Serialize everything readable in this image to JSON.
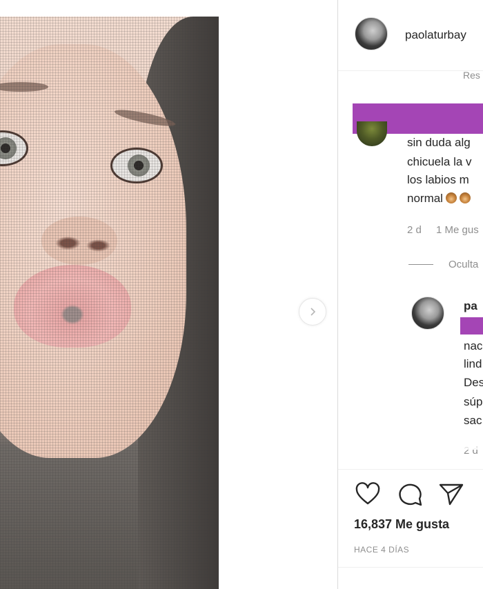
{
  "post": {
    "username": "paolaturbay",
    "reply_link": "Res"
  },
  "comments": [
    {
      "lines": [
        "sin duda alg",
        "chicuela la v",
        "los labios m",
        "normal"
      ],
      "time": "2 d",
      "likes": "1 Me gus",
      "hide_replies": "Oculta"
    }
  ],
  "reply": {
    "username": "pa",
    "lines": [
      "nac",
      "lind",
      "Des",
      "súp",
      "sac"
    ],
    "time": "2 d"
  },
  "actions": {
    "like_count": "16,837 Me gusta",
    "posted": "HACE 4 DÍAS"
  },
  "colors": {
    "redaction": "#a445b5",
    "border": "#dbdbdb",
    "muted": "#8e8e8e",
    "text": "#262626"
  },
  "icons": [
    "chevron-right-icon",
    "heart-icon",
    "comment-icon",
    "share-icon",
    "monkey-emoji-icon"
  ]
}
